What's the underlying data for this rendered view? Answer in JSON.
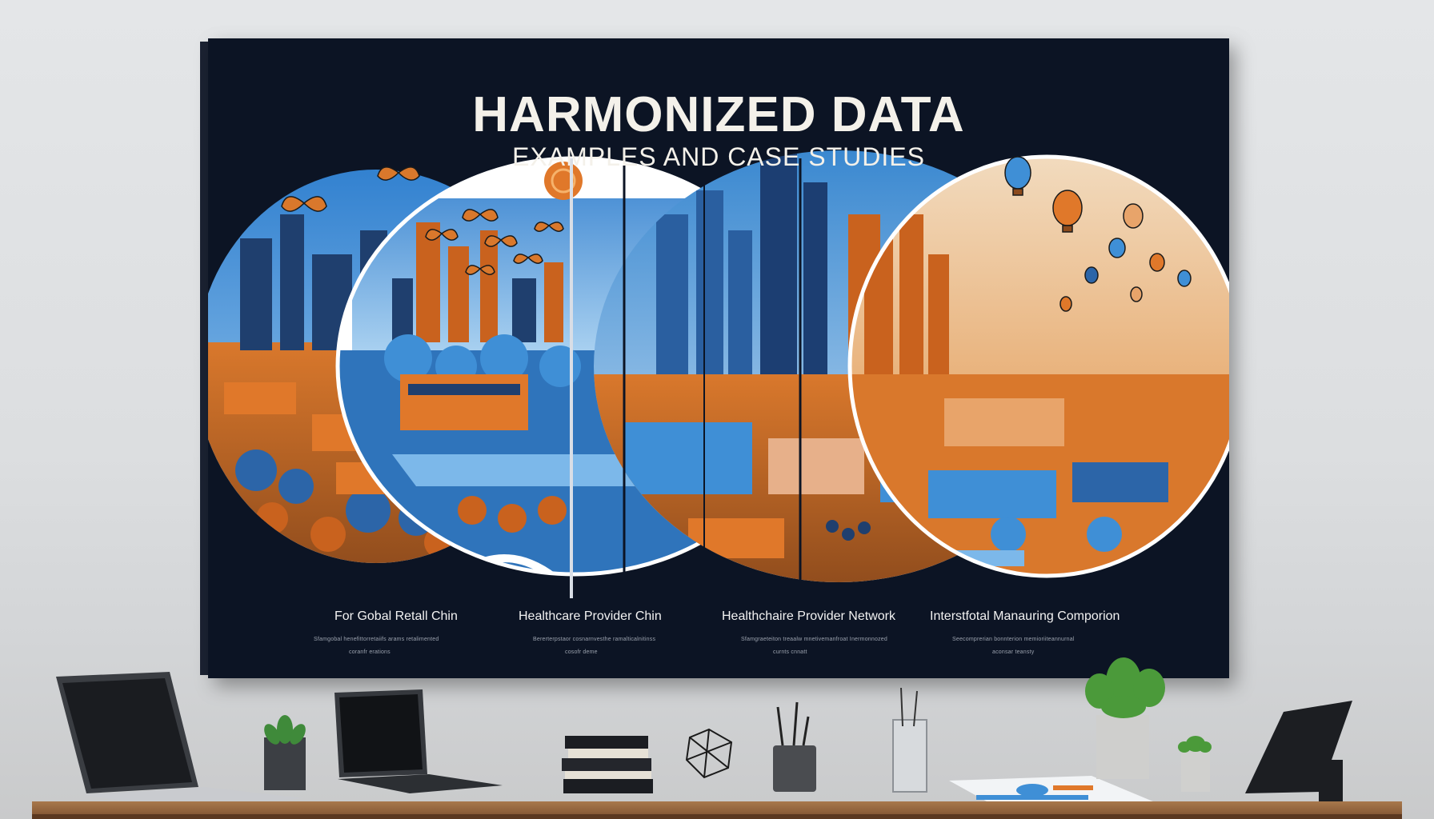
{
  "poster": {
    "title": "HARMONIZED DATA",
    "subtitle": "EXAMPLES AND CASE STUDIES",
    "panels": [
      {
        "caption": "For Gobal Retall Chin",
        "fine_line_1": "Sfamgobal henefittorretaiifs arams retalimented",
        "fine_line_2": "coranfr erations"
      },
      {
        "caption": "Healthcare Provider Chin",
        "fine_line_1": "Bererterpstaor cosnarnvesthe ramalticalnitinss",
        "fine_line_2": "cosofr deme"
      },
      {
        "caption": "Healthchaire Provider Network",
        "fine_line_1": "Sfamgraeteiton treaalw mnetivemanfroat Inermonnozed",
        "fine_line_2": "curnts cnnatt"
      },
      {
        "caption": "Interstfotal Manauring Comporion",
        "fine_line_1": "Seecomprerian bonnterion memioriiteannurnal",
        "fine_line_2": "aconsar teansty"
      }
    ]
  },
  "colors": {
    "wall": "#dfe1e3",
    "poster_bg": "#0c1424",
    "accent_orange": "#e0782a",
    "accent_blue": "#3f8fd6",
    "desk": "#8e603a"
  },
  "icons": [
    "butterfly-icon",
    "hot-air-balloon-icon",
    "sun-icon",
    "potted-plant-icon",
    "laptop-icon"
  ]
}
